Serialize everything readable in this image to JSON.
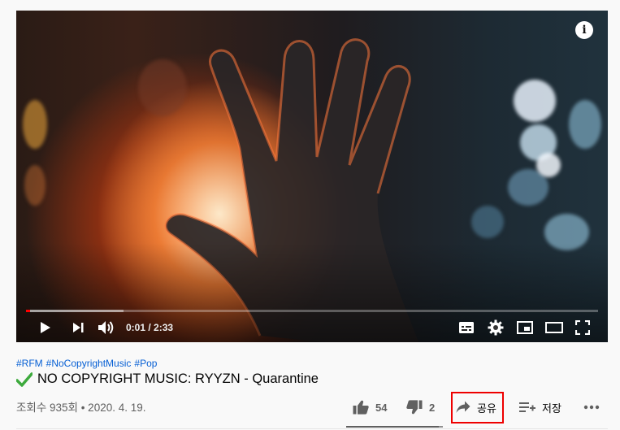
{
  "video": {
    "current_time": "0:01",
    "duration": "2:33",
    "time_display": "0:01 / 2:33",
    "played_fraction": 0.0065,
    "loaded_fraction": 0.17
  },
  "info": {
    "hashtags": [
      "#RFM",
      "#NoCopyrightMusic",
      "#Pop"
    ],
    "title": "NO COPYRIGHT MUSIC: RYYZN - Quarantine",
    "views_date": "조회수 935회 • 2020. 4. 19."
  },
  "actions": {
    "like_count": "54",
    "dislike_count": "2",
    "share_label": "공유",
    "save_label": "저장",
    "like_ratio": 0.96
  },
  "colors": {
    "accent": "#ff0000",
    "link": "#065fd4",
    "highlight_box": "#ee0000",
    "check": "#4caf50"
  },
  "icons": [
    "info-icon",
    "play-icon",
    "next-icon",
    "volume-icon",
    "subtitles-icon",
    "settings-icon",
    "miniplayer-icon",
    "theater-icon",
    "fullscreen-icon",
    "checkmark-icon",
    "thumbs-up-icon",
    "thumbs-down-icon",
    "share-icon",
    "save-playlist-icon",
    "more-icon"
  ]
}
